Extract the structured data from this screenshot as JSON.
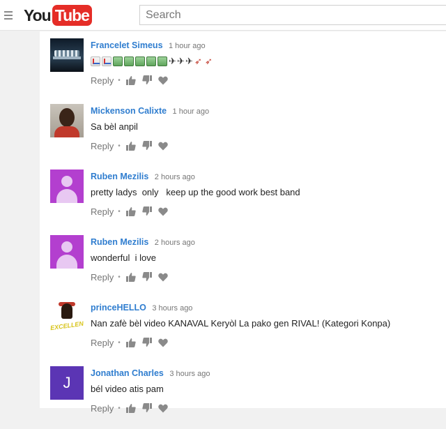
{
  "search": {
    "placeholder": "Search"
  },
  "logo": {
    "you": "You",
    "tube": "Tube"
  },
  "actions": {
    "reply_label": "Reply",
    "separator": "•"
  },
  "comments": [
    {
      "author": "Francelet Simeus",
      "time": "1 hour ago",
      "text": "",
      "avatar": "photo-night",
      "emoji": [
        "chart",
        "chart",
        "bill",
        "bill",
        "bill",
        "bill",
        "bill",
        "airplane",
        "airplane",
        "airplane",
        "rocket",
        "rocket"
      ]
    },
    {
      "author": "Mickenson Calixte",
      "time": "1 hour ago",
      "text": "Sa bèl anpil",
      "avatar": "photo-man"
    },
    {
      "author": "Ruben Mezilis",
      "time": "2 hours ago",
      "text": "pretty ladys  only   keep up the good work best band",
      "avatar": "default"
    },
    {
      "author": "Ruben Mezilis",
      "time": "2 hours ago",
      "text": "wonderful  i love",
      "avatar": "default"
    },
    {
      "author": "princeHELLO",
      "time": "3 hours ago",
      "text": "Nan zafè bèl video KANAVAL Keryòl La pako gen RIVAL! (Kategori Konpa)",
      "avatar": "photo-logo",
      "avatar_text": "EXCELLENT"
    },
    {
      "author": "Jonathan Charles",
      "time": "3 hours ago",
      "text": "bél video atis pam",
      "avatar": "letter",
      "avatar_letter": "J"
    }
  ],
  "colors": {
    "author": "#2f7dcf",
    "youtube_red": "#e52d27",
    "default_avatar": "#b33fcf",
    "letter_avatar": "#5b35b4"
  }
}
